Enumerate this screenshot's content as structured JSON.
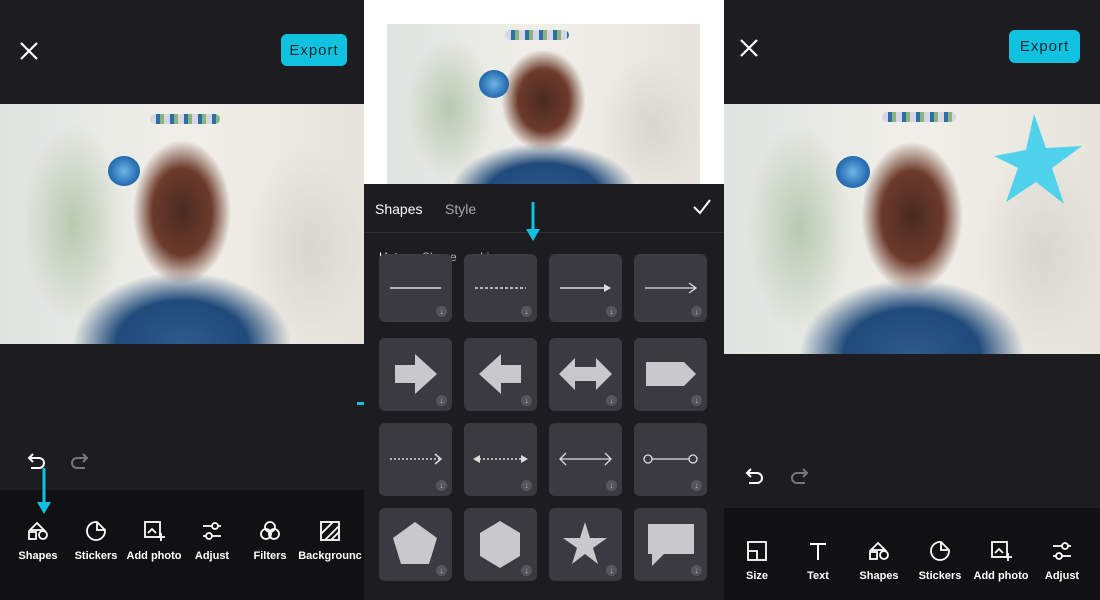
{
  "panel_left": {
    "export_label": "Export",
    "toolbar": [
      {
        "label": "Shapes",
        "icon": "shapes-icon"
      },
      {
        "label": "Stickers",
        "icon": "stickers-icon"
      },
      {
        "label": "Add photo",
        "icon": "add-photo-icon"
      },
      {
        "label": "Adjust",
        "icon": "adjust-icon"
      },
      {
        "label": "Filters",
        "icon": "filters-icon"
      },
      {
        "label": "Backgrounc",
        "icon": "background-icon"
      }
    ]
  },
  "panel_middle": {
    "tabs": [
      {
        "label": "Shapes"
      },
      {
        "label": "Style"
      }
    ],
    "subtabs": [
      {
        "label": "Hot"
      },
      {
        "label": "Shape"
      },
      {
        "label": "Line"
      }
    ],
    "shape_items": [
      "line-solid",
      "line-dashed",
      "arrow-line",
      "arrow-line-thin",
      "arrow-right",
      "arrow-left",
      "arrow-double",
      "tag-arrow",
      "dotted-arrow",
      "dotted-double-arrow",
      "double-arrow-line",
      "circle-connector",
      "pentagon",
      "hexagon",
      "star",
      "speech-bubble"
    ]
  },
  "panel_right": {
    "export_label": "Export",
    "toolbar": [
      {
        "label": "Size",
        "icon": "size-icon"
      },
      {
        "label": "Text",
        "icon": "text-icon"
      },
      {
        "label": "Shapes",
        "icon": "shapes-icon"
      },
      {
        "label": "Stickers",
        "icon": "stickers-icon"
      },
      {
        "label": "Add photo",
        "icon": "add-photo-icon"
      },
      {
        "label": "Adjust",
        "icon": "adjust-icon"
      }
    ]
  },
  "colors": {
    "accent": "#11c2e0",
    "bg": "#1c1c21",
    "toolbar": "#111114",
    "tile": "#3a3a40"
  }
}
